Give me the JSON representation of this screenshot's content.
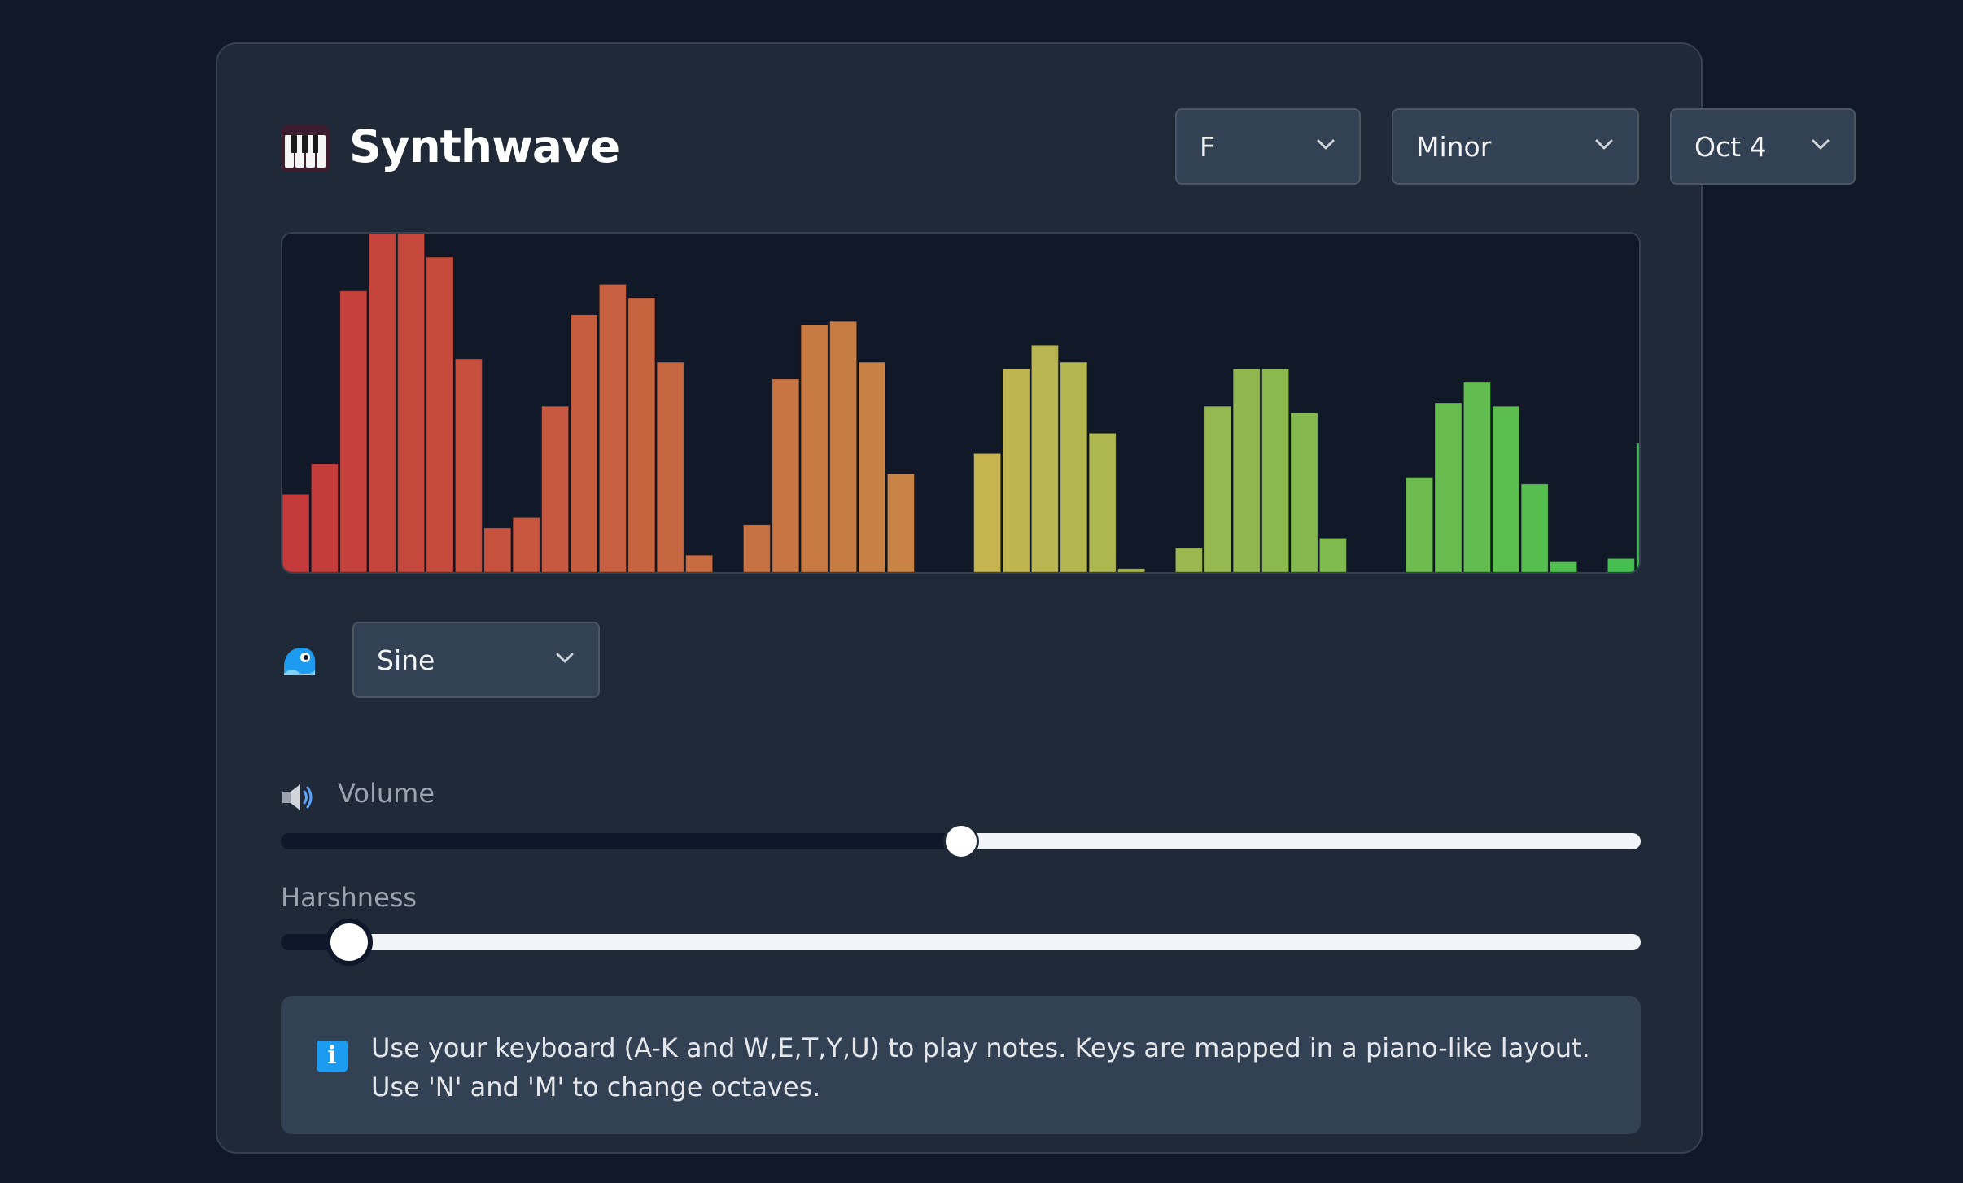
{
  "app": {
    "title": "Synthwave",
    "icon": "piano-keyboard-icon"
  },
  "controls": {
    "key": {
      "value": "F",
      "options_visible": [
        "F"
      ]
    },
    "scale": {
      "value": "Minor"
    },
    "octave": {
      "value": "Oct 4"
    },
    "waveform": {
      "value": "Sine",
      "icon": "wave-icon"
    }
  },
  "volume": {
    "label": "Volume",
    "icon": "speaker-icon",
    "value_fraction": 0.5
  },
  "harshness": {
    "label": "Harshness",
    "value_fraction": 0.05
  },
  "info": {
    "icon": "info-icon",
    "text": "Use your keyboard (A-K and W,E,T,Y,U) to play notes. Keys are mapped in a piano-like layout. Use 'N' and 'M' to change octaves."
  },
  "visualizer": {
    "bar_levels": [
      0.23,
      0.32,
      0.83,
      1.0,
      1.0,
      0.93,
      0.63,
      0.13,
      0.16,
      0.49,
      0.76,
      0.85,
      0.81,
      0.62,
      0.05,
      0,
      0.14,
      0.57,
      0.73,
      0.74,
      0.62,
      0.29,
      0,
      0,
      0.35,
      0.6,
      0.67,
      0.62,
      0.41,
      0.01,
      0,
      0.07,
      0.49,
      0.6,
      0.6,
      0.47,
      0.1,
      0,
      0,
      0.28,
      0.5,
      0.56,
      0.49,
      0.26,
      0.03,
      0,
      0.04,
      0.38
    ],
    "color_start": "#c53a3a",
    "color_end": "#3fbf4f"
  }
}
